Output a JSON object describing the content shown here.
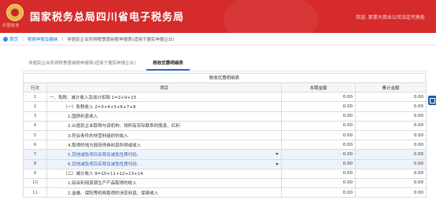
{
  "header": {
    "title": "国家税务总局四川省电子税务局",
    "emblem_caption": "中国税务",
    "welcome": "欢迎, 那拿大商业公司法定代表处"
  },
  "breadcrumb": {
    "items": [
      "首页",
      "税费申报及缴纳",
      "非居民企业所得税季度纳税申报表(适用于据实申报企业)"
    ]
  },
  "tabs": [
    {
      "label": "非居民企业所得税季度纳税申报表(适用于据实申报企业)",
      "active": false
    },
    {
      "label": "税收优惠明细表",
      "active": true
    }
  ],
  "table": {
    "caption": "税收优惠明细表",
    "columns": [
      "行次",
      "项目",
      "本期金额",
      "累计金额"
    ],
    "rows": [
      {
        "no": "1",
        "item": "一、免税、减计收入及加计扣除 1=2+9+15",
        "cur": "0.00",
        "cum": "0.00",
        "indent": 0,
        "select": false
      },
      {
        "no": "2",
        "item": "（一）免税收入 2=3+4+5+6+7+8",
        "cur": "0.00",
        "cum": "0.00",
        "indent": 1,
        "select": false
      },
      {
        "no": "3",
        "item": "1.国债利息收入",
        "cur": "0.00",
        "cum": "0.00",
        "indent": 2,
        "select": false
      },
      {
        "no": "4",
        "item": "2.从居民企业取得与该机构、场所有实际联系的股息、红利",
        "cur": "0.00",
        "cum": "0.00",
        "indent": 2,
        "select": false
      },
      {
        "no": "5",
        "item": "3.符合条件的非营利组织的收入",
        "cur": "0.00",
        "cum": "0.00",
        "indent": 2,
        "select": false
      },
      {
        "no": "6",
        "item": "4.取得的地方政府债券利息所得或收入",
        "cur": "0.00",
        "cum": "0.00",
        "indent": 2,
        "select": false
      },
      {
        "no": "7",
        "item": "5.其他减免项目名称及减免性质代码:",
        "cur": "0.00",
        "cum": "0.00",
        "indent": 2,
        "select": true
      },
      {
        "no": "8",
        "item": "6.其他减免项目名称及减免性质代码:",
        "cur": "0.00",
        "cum": "0.00",
        "indent": 2,
        "select": true
      },
      {
        "no": "9",
        "item": "（二）减计收入 9=10+11+12+13+14",
        "cur": "0.00",
        "cum": "0.00",
        "indent": 1,
        "select": false
      },
      {
        "no": "10",
        "item": "1.综合利用资源生产产品取得的收入",
        "cur": "0.00",
        "cum": "0.00",
        "indent": 2,
        "select": false
      },
      {
        "no": "11",
        "item": "2.金融、保险等机构取得的涉农利息、保费收入",
        "cur": "0.00",
        "cum": "0.00",
        "indent": 2,
        "select": false
      }
    ]
  }
}
